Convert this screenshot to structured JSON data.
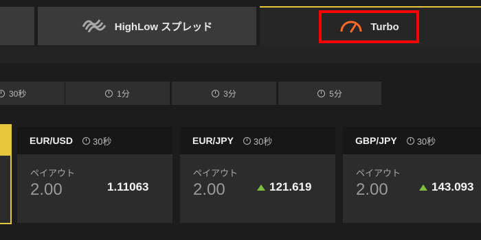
{
  "tabs": {
    "highlow_label": "HighLow スプレッド",
    "turbo_label": "Turbo"
  },
  "durations": [
    "30秒",
    "1分",
    "3分",
    "5分"
  ],
  "cards": [
    {
      "pair": "EUR/USD",
      "duration": "30秒",
      "payout_label": "ペイアウト",
      "payout": "2.00",
      "rate": "1.11063",
      "direction": "none"
    },
    {
      "pair": "EUR/JPY",
      "duration": "30秒",
      "payout_label": "ペイアウト",
      "payout": "2.00",
      "rate": "121.619",
      "direction": "up"
    },
    {
      "pair": "GBP/JPY",
      "duration": "30秒",
      "payout_label": "ペイアウト",
      "payout": "2.00",
      "rate": "143.093",
      "direction": "up"
    }
  ],
  "colors": {
    "accent": "#e6c73c",
    "highlight": "#ff0000",
    "up": "#7fbf3f",
    "turbo_icon": "#ff6a2a"
  },
  "icons": {
    "highlow": "highlow-stripes-icon",
    "turbo": "speedometer-icon",
    "clock": "clock-icon"
  }
}
